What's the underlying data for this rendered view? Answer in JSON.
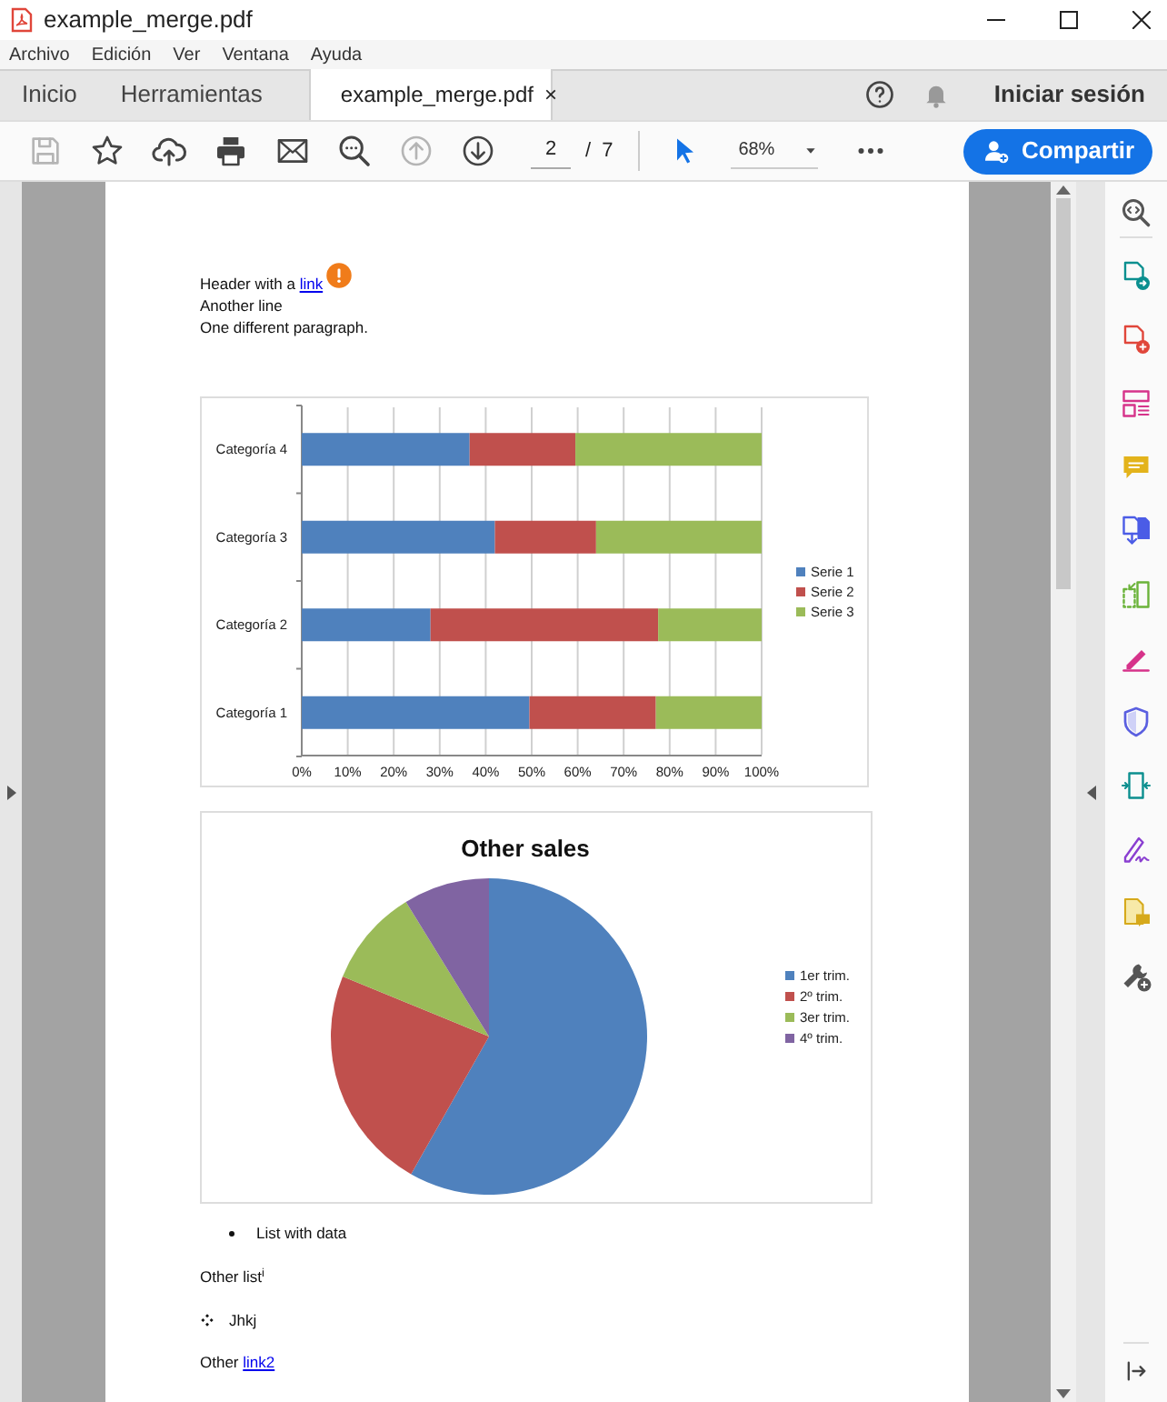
{
  "window": {
    "title": "example_merge.pdf"
  },
  "menu": [
    "Archivo",
    "Edición",
    "Ver",
    "Ventana",
    "Ayuda"
  ],
  "tabs": [
    {
      "label": "Inicio",
      "selected": false
    },
    {
      "label": "Herramientas",
      "selected": false
    },
    {
      "label": "example_merge.pdf",
      "selected": true,
      "close": "×"
    }
  ],
  "header_actions": {
    "sign_in": "Iniciar sesión"
  },
  "toolbar": {
    "tools": [
      {
        "kind": "save",
        "disabled": true
      },
      {
        "kind": "star",
        "disabled": false
      },
      {
        "kind": "upload",
        "disabled": false
      },
      {
        "kind": "print",
        "disabled": false
      },
      {
        "kind": "mail",
        "disabled": false
      },
      {
        "kind": "zoom_search",
        "disabled": false
      },
      {
        "kind": "page_up",
        "disabled": true
      },
      {
        "kind": "page_down",
        "disabled": false
      }
    ],
    "page": "2",
    "page_separator": "/",
    "page_count": "7",
    "select_tool": {
      "selected": true
    },
    "zoom": "68%",
    "share": "Compartir"
  },
  "document": {
    "header": {
      "text": "Header with a ",
      "link": "link"
    },
    "lines": [
      "Another line",
      "One different paragraph."
    ],
    "bar_chart": {
      "chart_data": {
        "type": "bar",
        "orientation": "horizontal",
        "stacked": true,
        "grid": true,
        "legend": true,
        "categories": [
          "Categoría 4",
          "Categoría 3",
          "Categoría 2",
          "Categoría 1"
        ],
        "xlim": [
          0,
          100
        ],
        "xticks": [
          {
            "value": 0,
            "label": "0%"
          },
          {
            "value": 10,
            "label": "10%"
          },
          {
            "value": 20,
            "label": "20%"
          },
          {
            "value": 30,
            "label": "30%"
          },
          {
            "value": 40,
            "label": "40%"
          },
          {
            "value": 50,
            "label": "50%"
          },
          {
            "value": 60,
            "label": "60%"
          },
          {
            "value": 70,
            "label": "70%"
          },
          {
            "value": 80,
            "label": "80%"
          },
          {
            "value": 90,
            "label": "90%"
          },
          {
            "value": 100,
            "label": "100%"
          }
        ],
        "series": [
          {
            "name": "Serie 1",
            "color": "#4f81bd",
            "values": [
              36.5,
              42,
              28,
              49.5
            ]
          },
          {
            "name": "Serie 2",
            "color": "#c0504d",
            "values": [
              23,
              22,
              49.5,
              27.5
            ]
          },
          {
            "name": "Serie 3",
            "color": "#9bbb59",
            "values": [
              40.5,
              36,
              22.5,
              23
            ]
          }
        ]
      }
    },
    "pie_chart": {
      "chart_data": {
        "type": "pie",
        "title": "Other sales",
        "legend": true,
        "categories": [
          "1er trim.",
          "2º trim.",
          "3er trim.",
          "4º trim."
        ],
        "series": [
          {
            "values": [
              58.2,
              23,
              10,
              8.8
            ]
          }
        ],
        "colors": [
          "#4f81bd",
          "#c0504d",
          "#9bbb59",
          "#8064a2"
        ]
      }
    },
    "bullet_item": "List with data",
    "other_list": "Other list$^{i}$",
    "diamond_item": "Jhkj",
    "last": {
      "text": "Other ",
      "link": "link2"
    }
  },
  "tools_panel": [
    {
      "kind": "zoom"
    },
    {
      "kind": "export"
    },
    {
      "kind": "create"
    },
    {
      "kind": "organize"
    },
    {
      "kind": "comment"
    },
    {
      "kind": "combine"
    },
    {
      "kind": "compress"
    },
    {
      "kind": "fill_sign"
    },
    {
      "kind": "protect"
    },
    {
      "kind": "redact"
    },
    {
      "kind": "sign"
    },
    {
      "kind": "send"
    },
    {
      "kind": "more"
    }
  ]
}
